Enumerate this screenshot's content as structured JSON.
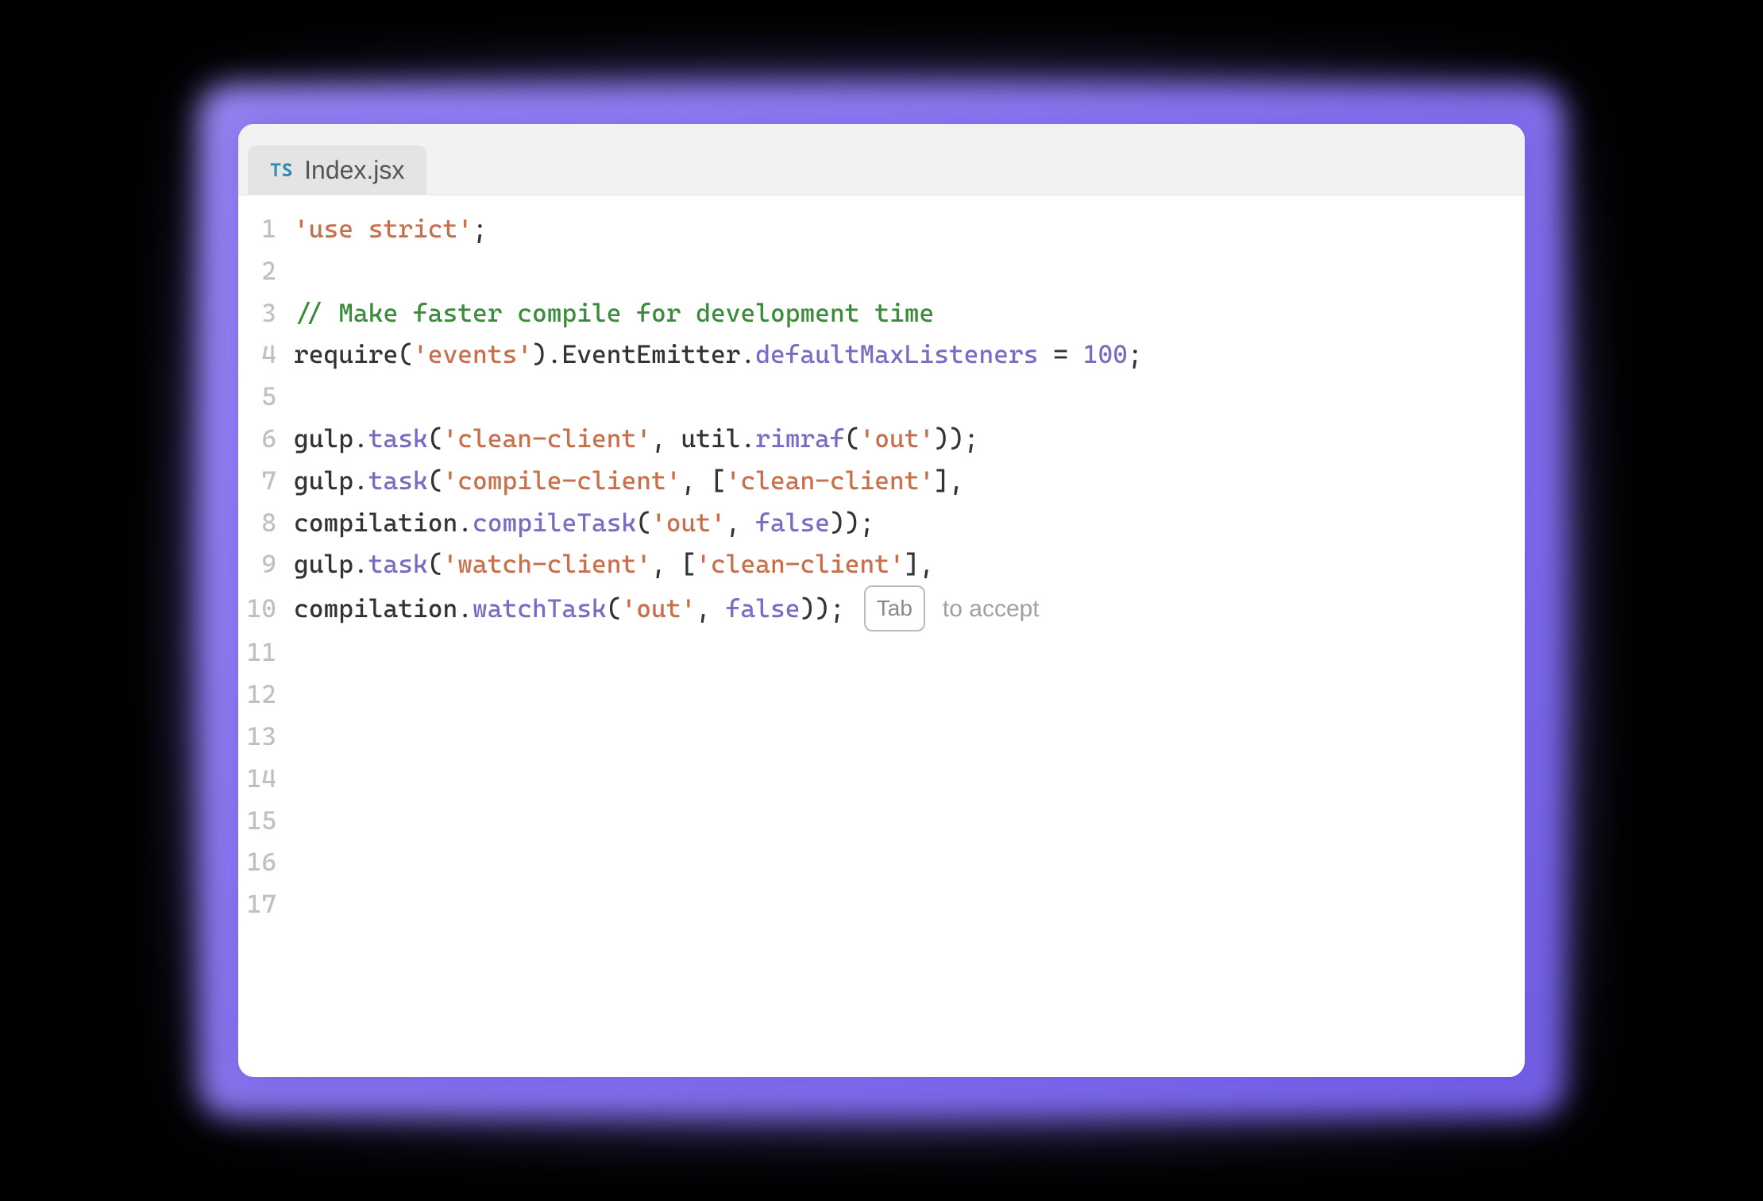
{
  "tab": {
    "icon_label": "TS",
    "filename": "Index.jsx"
  },
  "lines": {
    "l1_str": "'use strict'",
    "l1_semi": ";",
    "l3_comment": "// Make faster compile for development time",
    "l4_require": "require",
    "l4_lp": "(",
    "l4_events": "'events'",
    "l4_rp": ")",
    "l4_dot1": ".",
    "l4_ee": "EventEmitter",
    "l4_dot2": ".",
    "l4_dml": "defaultMaxListeners",
    "l4_eq": " = ",
    "l4_num": "100",
    "l4_semi": ";",
    "l6_gulp": "gulp",
    "l6_dot": ".",
    "l6_task": "task",
    "l6_lp": "(",
    "l6_s1": "'clean-client'",
    "l6_c": ", ",
    "l6_util": "util",
    "l6_dot2": ".",
    "l6_rimraf": "rimraf",
    "l6_lp2": "(",
    "l6_out": "'out'",
    "l6_rp": "));",
    "l7_gulp": "gulp",
    "l7_dot": ".",
    "l7_task": "task",
    "l7_lp": "(",
    "l7_s1": "'compile-client'",
    "l7_c": ", [",
    "l7_s2": "'clean-client'",
    "l7_rb": "],",
    "l8_comp": "compilation",
    "l8_dot": ".",
    "l8_ct": "compileTask",
    "l8_lp": "(",
    "l8_out": "'out'",
    "l8_c": ", ",
    "l8_false": "false",
    "l8_rp": "));",
    "l9_gulp": "gulp",
    "l9_dot": ".",
    "l9_task": "task",
    "l9_lp": "(",
    "l9_s1": "'watch-client'",
    "l9_c": ", [",
    "l9_s2": "'clean-client'",
    "l9_rb": "],",
    "l10_comp": "compilation",
    "l10_dot": ".",
    "l10_wt": "watchTask",
    "l10_lp": "(",
    "l10_out": "'out'",
    "l10_c": ", ",
    "l10_false": "false",
    "l10_rp": "));"
  },
  "gutter": {
    "n1": "1",
    "n2": "2",
    "n3": "3",
    "n4": "4",
    "n5": "5",
    "n6": "6",
    "n7": "7",
    "n8": "8",
    "n9": "9",
    "n10": "10",
    "n11": "11",
    "n12": "12",
    "n13": "13",
    "n14": "14",
    "n15": "15",
    "n16": "16",
    "n17": "17"
  },
  "suggestion": {
    "key_label": "Tab",
    "accept_text": "to accept"
  }
}
